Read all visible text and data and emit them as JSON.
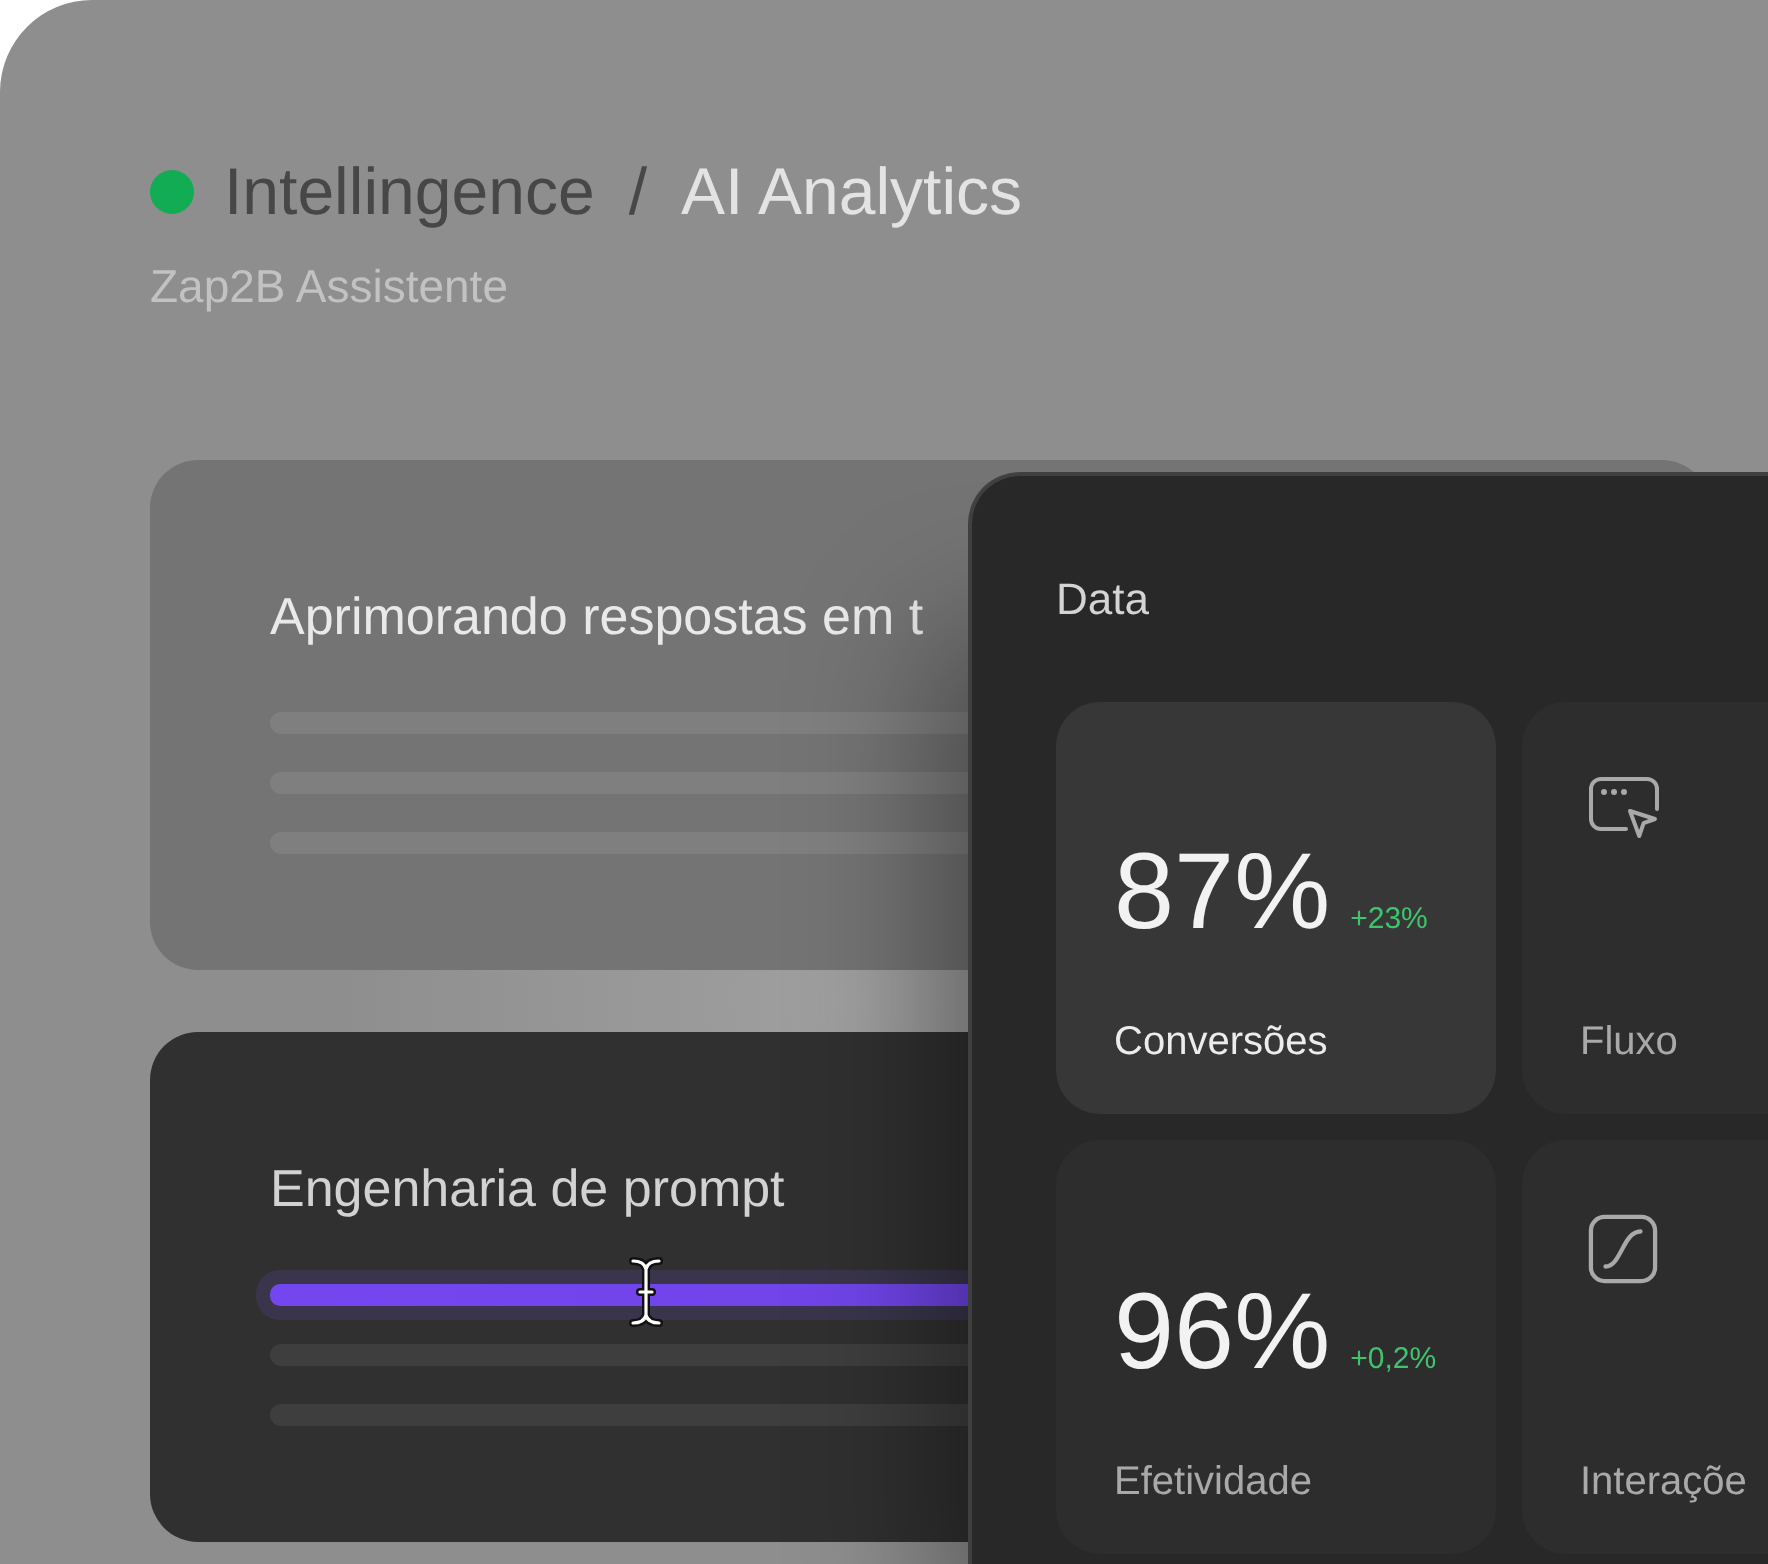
{
  "header": {
    "breadcrumb": [
      {
        "label": "Intellingence",
        "current": false
      },
      {
        "label": "AI Analytics",
        "current": true
      }
    ],
    "separator": "/",
    "subtitle": "Zap2B Assistente"
  },
  "cards": [
    {
      "title": "Aprimorando respostas em t",
      "active": false,
      "lines": [
        {
          "highlighted": false
        },
        {
          "highlighted": false
        },
        {
          "highlighted": false
        }
      ]
    },
    {
      "title": "Engenharia de prompt",
      "active": true,
      "lines": [
        {
          "highlighted": true
        },
        {
          "highlighted": false
        },
        {
          "highlighted": false
        }
      ]
    }
  ],
  "panel": {
    "title": "Data",
    "tiles": [
      {
        "kind": "metric",
        "value": "87%",
        "delta": "+23%",
        "label": "Conversões",
        "selected": true
      },
      {
        "kind": "icon",
        "label": "Fluxo",
        "selected": false
      },
      {
        "kind": "metric",
        "value": "96%",
        "delta": "+0,2%",
        "label": "Efetividade",
        "selected": false
      },
      {
        "kind": "icon",
        "label": "Interaçõe",
        "selected": false
      }
    ]
  }
}
